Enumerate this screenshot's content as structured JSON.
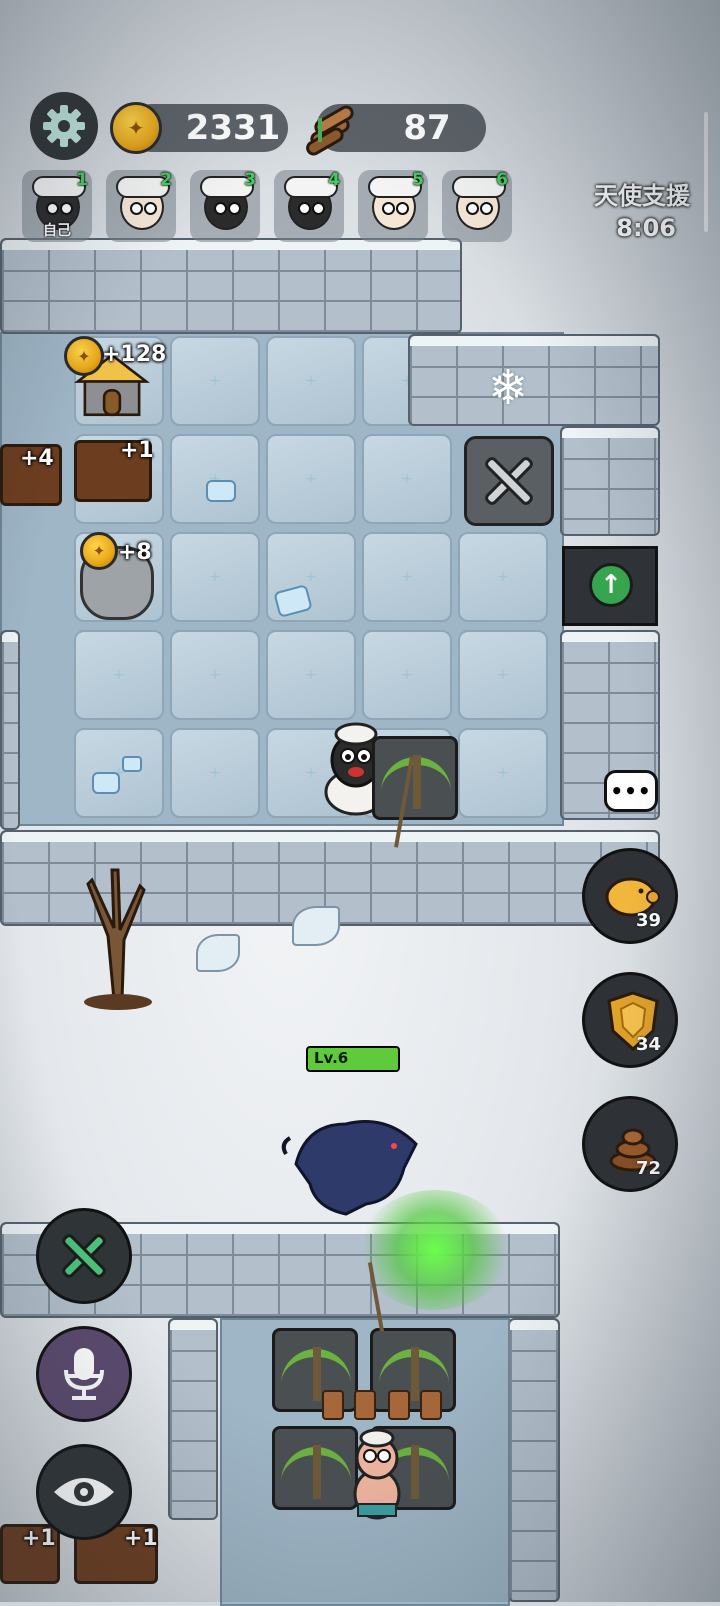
{
  "hud": {
    "settings_icon": "gear-icon",
    "gold": "2331",
    "wood": "87",
    "gold_icon": "gold-coin-icon",
    "wood_icon": "wood-logs-icon"
  },
  "players": [
    {
      "num": "1",
      "label": "自己",
      "style": "dark-eyes"
    },
    {
      "num": "2",
      "label": "",
      "style": "pink"
    },
    {
      "num": "3",
      "label": "",
      "style": "black"
    },
    {
      "num": "4",
      "label": "",
      "style": "black"
    },
    {
      "num": "5",
      "label": "",
      "style": "pink"
    },
    {
      "num": "6",
      "label": "",
      "style": "pink"
    }
  ],
  "angel_support": {
    "title": "天使支援",
    "time": "8:06"
  },
  "structures": {
    "hut_gain": "+128",
    "logs_gain_a": "+4",
    "logs_gain_b": "+1",
    "rock_gain": "+8",
    "bottom_logs_gain_a": "+1",
    "bottom_logs_gain_b": "+1"
  },
  "enemy": {
    "level": "Lv.6",
    "hp_fraction": 1.0
  },
  "side_buttons": {
    "piggy": {
      "count": "39",
      "icon": "piggy-bank-icon"
    },
    "shield": {
      "count": "34",
      "icon": "shield-icon"
    },
    "poop": {
      "count": "72",
      "icon": "poop-icon"
    }
  },
  "chat": {
    "text": "•••"
  },
  "left_buttons": {
    "build": "build-tools-icon",
    "voice": "microphone-icon",
    "view": "eye-icon"
  },
  "colors": {
    "accent_green": "#5fcb3a",
    "player_num": "#3fd15a",
    "gold": "#e9a81a"
  }
}
